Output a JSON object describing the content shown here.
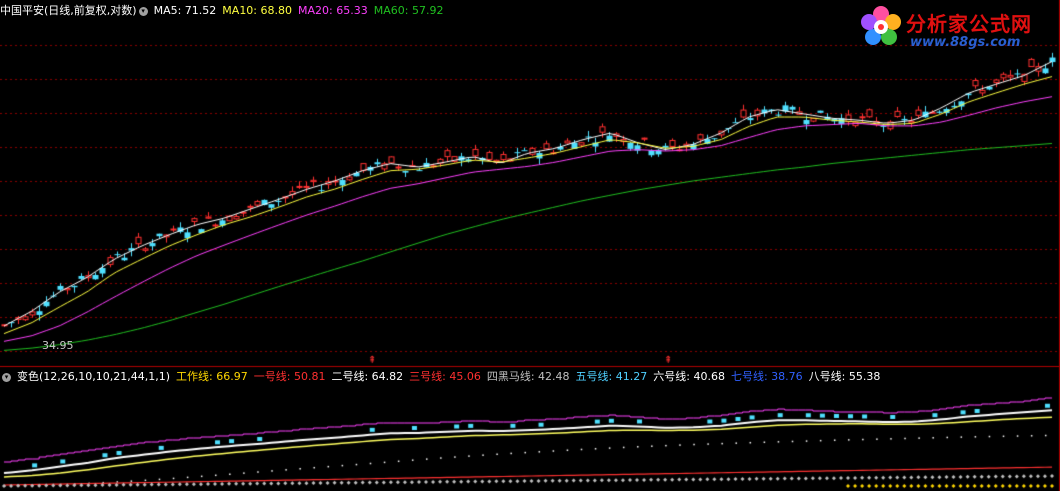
{
  "header": {
    "title": "中国平安(日线,前复权,对数)",
    "ma5": "MA5: 71.52",
    "ma10": "MA10: 68.80",
    "ma20": "MA20: 65.33",
    "ma60": "MA60: 57.92"
  },
  "indicator": {
    "name": "变色(12,26,10,10,21,44,1,1)",
    "lines": [
      {
        "label": "工作线: 66.97",
        "color": "#ffd700"
      },
      {
        "label": "一号线: 50.81",
        "color": "#ff3030"
      },
      {
        "label": "二号线: 64.82",
        "color": "#ffffff"
      },
      {
        "label": "三号线: 45.06",
        "color": "#ff3030"
      },
      {
        "label": "四黑马线: 42.48",
        "color": "#c0c0c0"
      },
      {
        "label": "五号线: 41.27",
        "color": "#4fd0ff"
      },
      {
        "label": "六号线: 40.68",
        "color": "#ffffff"
      },
      {
        "label": "七号线: 38.76",
        "color": "#3060ff"
      },
      {
        "label": "八号线: 55.38",
        "color": "#ffffff"
      }
    ]
  },
  "logo": {
    "name": "分析家公式网",
    "url": "www.88gs.com"
  },
  "colors": {
    "up": "#ff3030",
    "down": "#4fe0ff",
    "ma5": "#ffffff",
    "ma10": "#ffff40",
    "ma20": "#ff40ff",
    "ma60": "#20c020",
    "grid": "#8b0000"
  },
  "chart_data": {
    "type": "line",
    "scale": "log",
    "low_label": "34.95",
    "ylim": [
      33,
      80
    ],
    "series": [
      {
        "name": "MA5",
        "values": [
          36.2,
          37.6,
          39.5,
          41.0,
          43.0,
          44.5,
          45.8,
          47.0,
          47.8,
          49.0,
          50.2,
          51.5,
          52.6,
          54.0,
          55.0,
          54.5,
          55.2,
          56.0,
          55.0,
          56.5,
          57.2,
          58.5,
          59.5,
          58.0,
          57.0,
          57.8,
          59.5,
          62.0,
          63.2,
          62.5,
          61.8,
          61.5,
          61.0,
          61.5,
          63.5,
          66.0,
          67.5,
          69.0,
          71.52
        ]
      },
      {
        "name": "MA10",
        "values": [
          35.5,
          36.5,
          38.0,
          39.5,
          41.5,
          43.0,
          44.5,
          45.8,
          47.0,
          48.0,
          49.2,
          50.5,
          51.5,
          52.8,
          54.0,
          54.2,
          54.8,
          55.5,
          55.2,
          55.8,
          56.5,
          57.5,
          58.5,
          58.0,
          57.2,
          57.5,
          58.5,
          60.5,
          62.0,
          62.0,
          61.5,
          61.2,
          60.8,
          61.0,
          62.5,
          64.5,
          66.0,
          67.5,
          68.8
        ]
      },
      {
        "name": "MA20",
        "values": [
          34.8,
          35.3,
          36.2,
          37.5,
          39.0,
          40.5,
          42.0,
          43.4,
          44.6,
          45.8,
          47.0,
          48.2,
          49.3,
          50.5,
          51.6,
          52.2,
          53.0,
          53.8,
          54.2,
          54.6,
          55.2,
          56.0,
          56.8,
          57.0,
          56.8,
          57.0,
          57.6,
          58.8,
          60.0,
          60.6,
          60.8,
          61.0,
          60.6,
          60.6,
          61.2,
          62.3,
          63.5,
          64.5,
          65.33
        ]
      },
      {
        "name": "MA60",
        "values": [
          34.0,
          34.2,
          34.5,
          34.9,
          35.4,
          36.0,
          36.7,
          37.5,
          38.3,
          39.2,
          40.1,
          41.0,
          41.9,
          42.8,
          43.8,
          44.8,
          45.8,
          46.7,
          47.6,
          48.4,
          49.2,
          50.0,
          50.7,
          51.4,
          52.0,
          52.6,
          53.1,
          53.6,
          54.1,
          54.5,
          55.0,
          55.4,
          55.8,
          56.2,
          56.6,
          57.0,
          57.3,
          57.6,
          57.92
        ]
      }
    ]
  }
}
